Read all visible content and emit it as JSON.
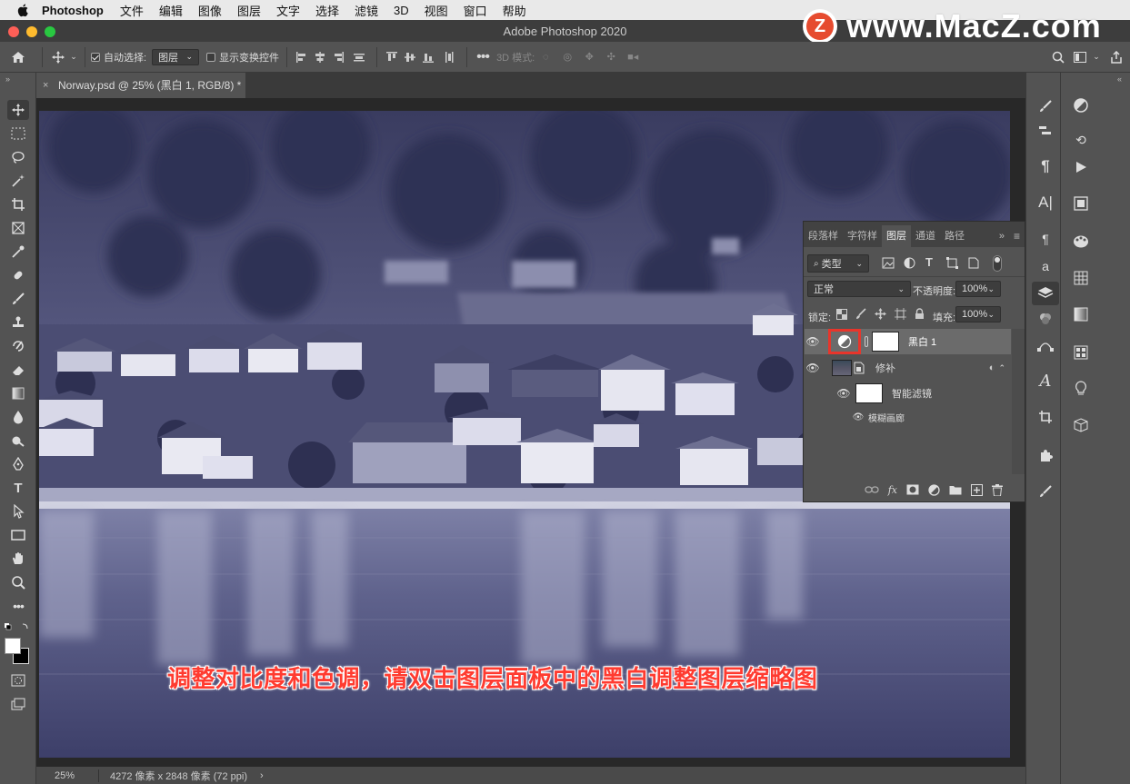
{
  "menubar": {
    "app_name": "Photoshop",
    "items": [
      "文件",
      "编辑",
      "图像",
      "图层",
      "文字",
      "选择",
      "滤镜",
      "3D",
      "视图",
      "窗口",
      "帮助"
    ]
  },
  "window": {
    "title": "Adobe Photoshop 2020"
  },
  "watermark": {
    "logo_letter": "Z",
    "text": "www.MacZ.com"
  },
  "options_bar": {
    "auto_select_label": "自动选择:",
    "auto_select_target": "图层",
    "show_transform_label": "显示变换控件",
    "mode_3d_label": "3D 模式:"
  },
  "document": {
    "tab_title": "Norway.psd @ 25% (黑白 1, RGB/8) *"
  },
  "caption": "调整对比度和色调，请双击图层面板中的黑白调整图层缩略图",
  "status": {
    "zoom": "25%",
    "info": "4272 像素 x 2848 像素 (72 ppi)"
  },
  "layers_panel": {
    "tabs": [
      "段落样",
      "字符样",
      "图层",
      "通道",
      "路径"
    ],
    "active_tab": "图层",
    "filter_kind": "类型",
    "blend_mode": "正常",
    "opacity_label": "不透明度:",
    "opacity_value": "100%",
    "lock_label": "锁定:",
    "fill_label": "填充:",
    "fill_value": "100%",
    "layers": [
      {
        "name": "黑白 1",
        "type": "adjustment",
        "selected": true
      },
      {
        "name": "修补",
        "type": "smart-object"
      },
      {
        "name": "智能滤镜",
        "type": "smart-filter-mask"
      },
      {
        "name": "模糊画廊",
        "type": "filter"
      }
    ]
  },
  "colors": {
    "highlight_box": "#e8352b",
    "caption": "#ff3b30",
    "brand": "#e64b2f"
  }
}
